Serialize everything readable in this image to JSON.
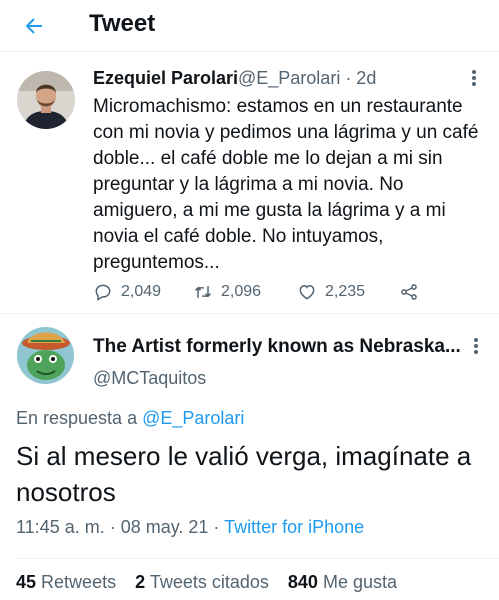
{
  "header": {
    "title": "Tweet"
  },
  "original_tweet": {
    "author_name": "Ezequiel Parolari",
    "handle_and_time": "@E_Parolari · 2d",
    "text": "Micromachismo: estamos en un restaurante con mi novia y pedimos una lágrima y un café doble... el café doble me lo dejan a mi sin preguntar y la lágrima a mi novia. No amiguero, a mi me gusta la lágrima y a mi novia el café doble. No intuyamos, preguntemos...",
    "replies": "2,049",
    "retweets": "2,096",
    "likes": "2,235"
  },
  "reply_tweet": {
    "author_name": "The Artist formerly known as Nebraska...",
    "handle": "@MCTaquitos",
    "reply_prefix": "En respuesta a ",
    "reply_to": "@E_Parolari",
    "text": "Si al mesero le valió verga, imagínate a nosotros",
    "timestamp": "11:45 a. m. · 08 may. 21 · ",
    "source": "Twitter for iPhone",
    "retweets_count": "45",
    "retweets_label": "Retweets",
    "quotes_count": "2",
    "quotes_label": "Tweets citados",
    "likes_count": "840",
    "likes_label": "Me gusta"
  },
  "colors": {
    "accent": "#1d9bf0",
    "secondary_text": "#536471",
    "primary_text": "#0f1419"
  }
}
